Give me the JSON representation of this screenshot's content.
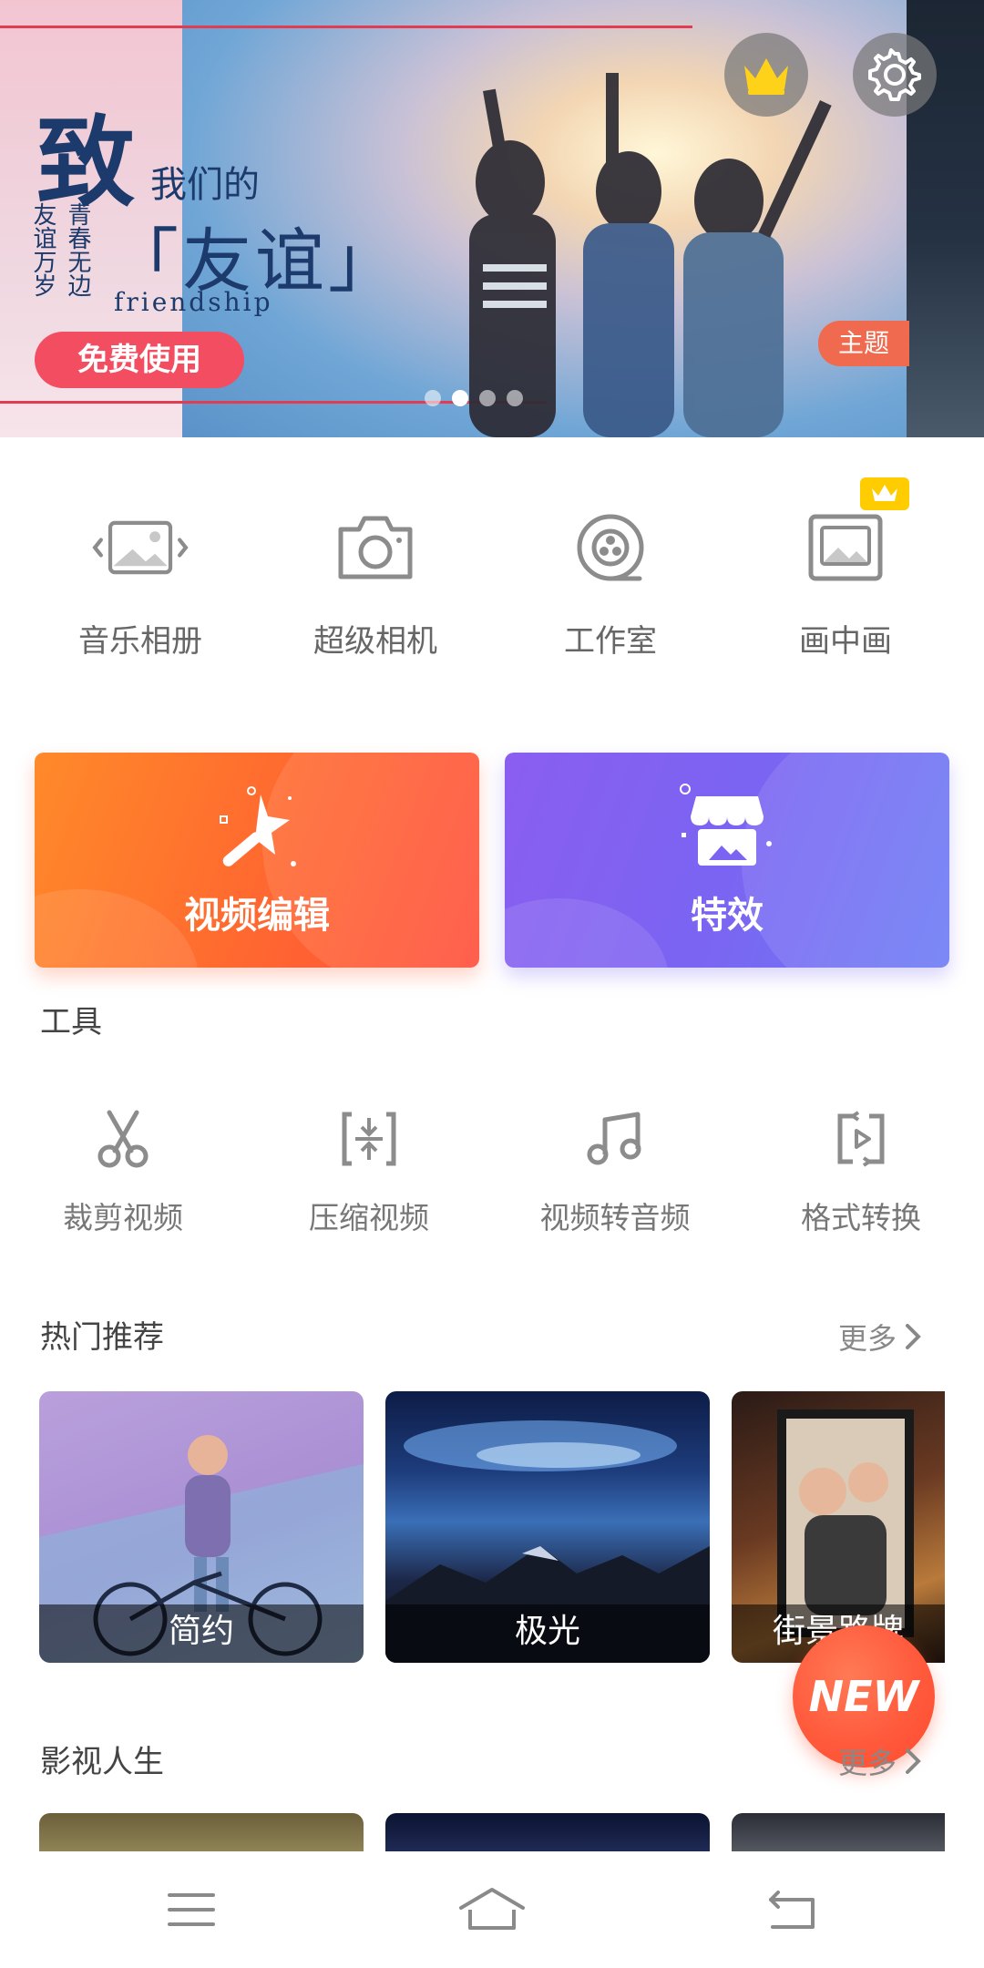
{
  "banner": {
    "title_big": "致",
    "title_small": "我们的",
    "title_mid": "「友谊」",
    "title_en": "friendship",
    "vertical_1": "友谊万岁",
    "vertical_2": "青春无边",
    "cta": "免费使用",
    "theme_tag": "主题",
    "dots": 4,
    "active_dot": 1
  },
  "quick_grid": [
    {
      "label": "音乐相册",
      "icon": "music-album-icon"
    },
    {
      "label": "超级相机",
      "icon": "camera-icon"
    },
    {
      "label": "工作室",
      "icon": "studio-reel-icon"
    },
    {
      "label": "画中画",
      "icon": "picture-in-picture-icon",
      "vip": true
    }
  ],
  "cards": [
    {
      "label": "视频编辑",
      "icon": "magic-wand-icon",
      "color": "#ff6a2f"
    },
    {
      "label": "特效",
      "icon": "storefront-icon",
      "color": "#7b64f2"
    }
  ],
  "tools": {
    "title": "工具",
    "items": [
      {
        "label": "裁剪视频",
        "icon": "scissors-icon"
      },
      {
        "label": "压缩视频",
        "icon": "compress-icon"
      },
      {
        "label": "视频转音频",
        "icon": "music-note-icon"
      },
      {
        "label": "格式转换",
        "icon": "convert-icon"
      }
    ]
  },
  "hot": {
    "title": "热门推荐",
    "more": "更多",
    "items": [
      {
        "label": "简约"
      },
      {
        "label": "极光"
      },
      {
        "label": "街景路牌"
      }
    ]
  },
  "film": {
    "title": "影视人生",
    "more": "更多"
  },
  "new_badge": "NEW",
  "colors": {
    "accent_red": "#f24d61",
    "orange_card": "#ff6a2f",
    "purple_card": "#7b64f2",
    "vip_yellow": "#ffcc00"
  }
}
